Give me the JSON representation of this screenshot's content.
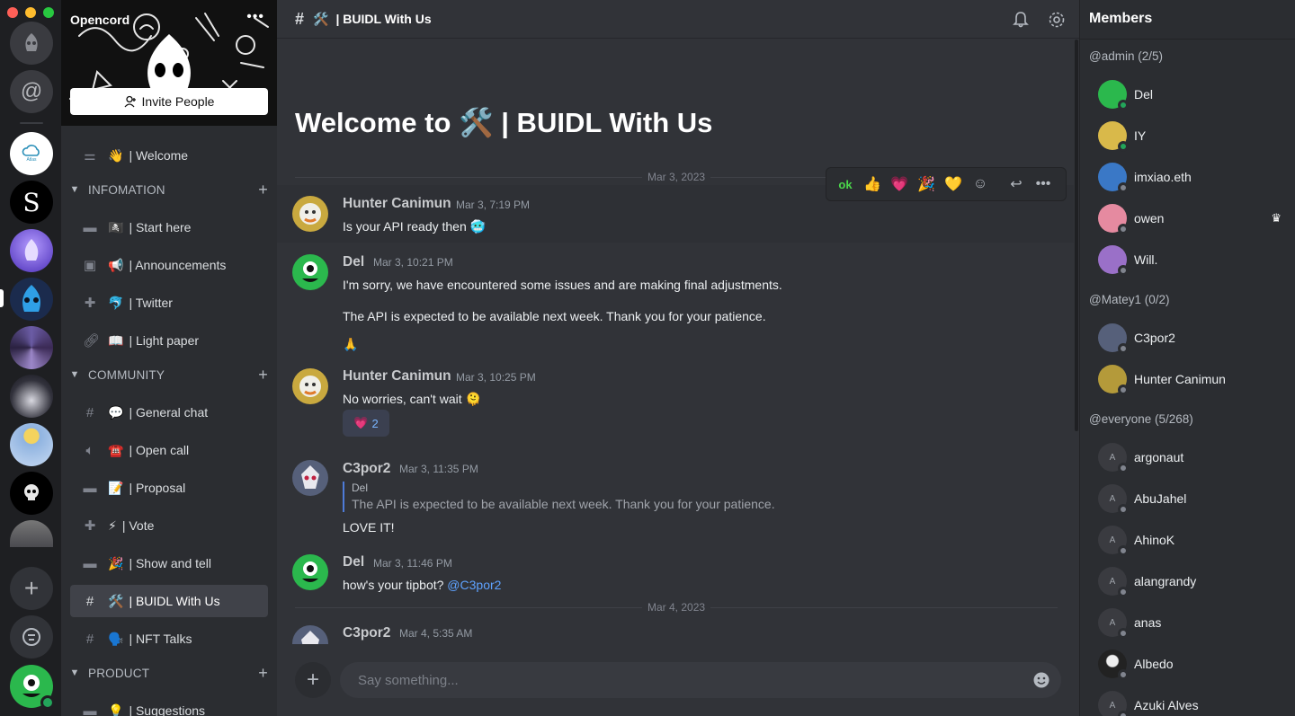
{
  "server": {
    "name": "Opencord",
    "invite_label": "Invite People"
  },
  "rail": {
    "servers": [
      "Atlas"
    ]
  },
  "sidebar": {
    "channels_top": [
      {
        "emoji": "👋",
        "name": "| Welcome"
      }
    ],
    "categories": [
      {
        "name": "INFOMATION",
        "channels": [
          {
            "emoji": "🏴‍☠️",
            "name": "| Start here"
          },
          {
            "emoji": "📢",
            "name": "| Announcements"
          },
          {
            "emoji": "🐬",
            "name": "| Twitter"
          },
          {
            "emoji": "📖",
            "name": "| Light paper"
          }
        ]
      },
      {
        "name": "COMMUNITY",
        "channels": [
          {
            "emoji": "💬",
            "name": "| General chat"
          },
          {
            "emoji": "☎️",
            "name": "| Open call"
          },
          {
            "emoji": "📝",
            "name": "| Proposal"
          },
          {
            "emoji": "⚡",
            "name": "| Vote"
          },
          {
            "emoji": "🎉",
            "name": "| Show and tell"
          },
          {
            "emoji": "🛠️",
            "name": "| BUIDL With Us"
          },
          {
            "emoji": "🗣️",
            "name": "| NFT Talks"
          }
        ]
      },
      {
        "name": "PRODUCT",
        "channels": [
          {
            "emoji": "💡",
            "name": "| Suggestions"
          }
        ]
      }
    ]
  },
  "header": {
    "channel_emoji": "🛠️",
    "channel_name": "| BUIDL With Us"
  },
  "welcome": {
    "prefix": "Welcome to",
    "emoji": "🛠️",
    "suffix": "| BUIDL With Us"
  },
  "dates": [
    "Mar 3, 2023",
    "Mar 4, 2023"
  ],
  "react_bar": [
    "🆗",
    "👍",
    "💗",
    "🎉",
    "💛"
  ],
  "messages": [
    {
      "author": "Hunter Canimun",
      "time": "Mar 3, 7:19 PM",
      "lines": [
        "Is your API ready then 🥶"
      ]
    },
    {
      "author": "Del",
      "time": "Mar 3, 10:21 PM",
      "lines": [
        "I'm sorry, we have encountered some issues and are making final adjustments.",
        "The API is expected to be available next week. Thank you for your patience.",
        "🙏"
      ]
    },
    {
      "author": "Hunter Canimun",
      "time": "Mar 3, 10:25 PM",
      "lines": [
        "No worries, can't wait 🫠"
      ],
      "reaction": {
        "emoji": "💗",
        "count": "2"
      }
    },
    {
      "author": "C3por2",
      "time": "Mar 3, 11:35 PM",
      "quote_author": "Del",
      "quote_text": "The API is expected to be available next week. Thank you for your patience.",
      "lines": [
        "LOVE IT!"
      ]
    },
    {
      "author": "Del",
      "time": "Mar 3, 11:46 PM",
      "lines": [
        "how's your tipbot?"
      ],
      "mention": "@C3por2"
    },
    {
      "author": "C3por2",
      "time": "Mar 4, 5:35 AM",
      "lines": []
    }
  ],
  "composer": {
    "placeholder": "Say something..."
  },
  "members": {
    "title": "Members",
    "groups": [
      {
        "role": "@admin (2/5)",
        "people": [
          {
            "name": "Del",
            "status": "online",
            "color": "#2fb84e"
          },
          {
            "name": "IY",
            "status": "online",
            "color": "#d9b94a"
          },
          {
            "name": "imxiao.eth",
            "status": "offline",
            "color": "#3a78c6"
          },
          {
            "name": "owen",
            "status": "offline",
            "color": "#e58aa0",
            "crown": "♛"
          },
          {
            "name": "Will.",
            "status": "offline",
            "color": "#9a70c8"
          }
        ]
      },
      {
        "role": "@Matey1 (0/2)",
        "people": [
          {
            "name": "C3por2",
            "status": "offline",
            "color": "#56607a"
          },
          {
            "name": "Hunter Canimun",
            "status": "offline",
            "color": "#b49a3a"
          }
        ]
      },
      {
        "role": "@everyone (5/268)",
        "people": [
          {
            "name": "argonaut",
            "status": "offline",
            "initial": "A"
          },
          {
            "name": "AbuJahel",
            "status": "offline",
            "initial": "A"
          },
          {
            "name": "AhinoK",
            "status": "offline",
            "initial": "A"
          },
          {
            "name": "alangrandy",
            "status": "offline",
            "initial": "A"
          },
          {
            "name": "anas",
            "status": "offline",
            "initial": "A"
          },
          {
            "name": "Albedo",
            "status": "offline",
            "color": "#222"
          },
          {
            "name": "Azuki Alves",
            "status": "offline",
            "initial": "A"
          }
        ]
      }
    ]
  },
  "colors": {
    "online": "#23a55a",
    "offline": "#80848e",
    "mention": "#5ea2ff",
    "accent": "#404249"
  }
}
